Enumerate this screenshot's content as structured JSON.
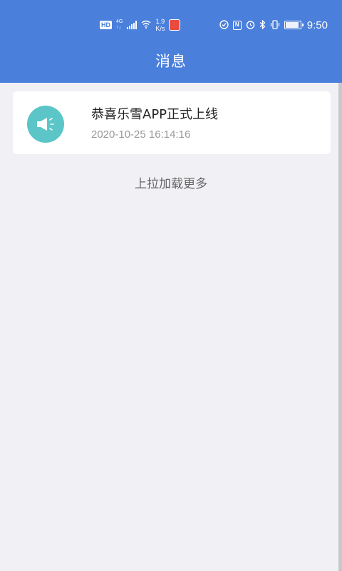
{
  "status_bar": {
    "hd": "HD",
    "network_top": "4G",
    "network_bottom": "↑↓",
    "speed_value": "1.9",
    "speed_unit": "K/s",
    "time": "9:50",
    "battery_level": 0.9
  },
  "header": {
    "title": "消息"
  },
  "messages": [
    {
      "title": "恭喜乐雪APP正式上线",
      "time": "2020-10-25 16:14:16",
      "icon": "megaphone-icon"
    }
  ],
  "list_footer": {
    "load_more": "上拉加载更多"
  },
  "colors": {
    "header_bg": "#4a7fdc",
    "page_bg": "#f1f1f5",
    "icon_bg": "#5bc5c7"
  }
}
